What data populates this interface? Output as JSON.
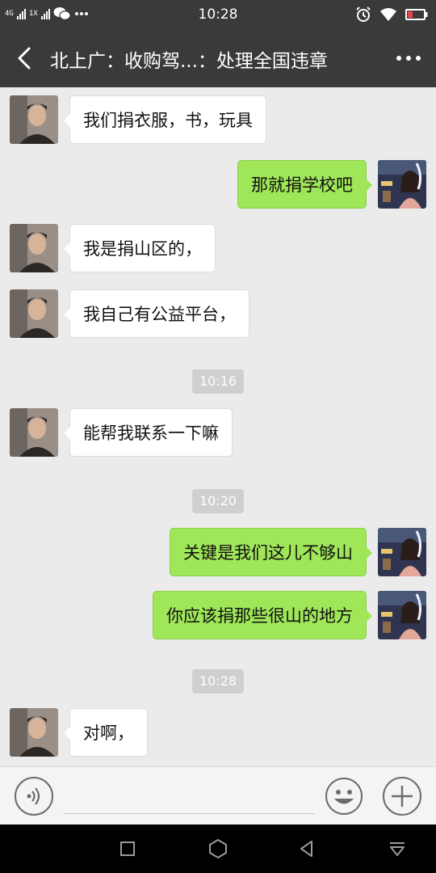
{
  "status_bar": {
    "network_1": "4G",
    "network_2": "1X",
    "time": "10:28",
    "icons": [
      "signal-icon",
      "wechat-icon",
      "more-dots-icon",
      "alarm-icon",
      "wifi-icon",
      "battery-icon"
    ],
    "battery_color": "#e5484d"
  },
  "header": {
    "title": "北上广：收购驾...：处理全国违章"
  },
  "messages": [
    {
      "side": "in",
      "text": "我们捐衣服，书，玩具"
    },
    {
      "side": "out",
      "text": "那就捐学校吧"
    },
    {
      "side": "in",
      "text": "我是捐山区的，"
    },
    {
      "side": "in",
      "text": "我自己有公益平台，"
    },
    {
      "side": "time",
      "text": "10:16"
    },
    {
      "side": "in",
      "text": "能帮我联系一下嘛"
    },
    {
      "side": "time",
      "text": "10:20"
    },
    {
      "side": "out",
      "text": "关键是我们这儿不够山"
    },
    {
      "side": "out",
      "text": "你应该捐那些很山的地方"
    },
    {
      "side": "time",
      "text": "10:28"
    },
    {
      "side": "in",
      "text": "对啊，"
    }
  ],
  "input": {
    "value": "",
    "placeholder": ""
  },
  "colors": {
    "header_bg": "#3a3a3a",
    "chat_bg": "#ebebeb",
    "outgoing_bubble": "#9fe658",
    "incoming_bubble": "#ffffff",
    "timestamp_bg": "#cfcfcf"
  }
}
